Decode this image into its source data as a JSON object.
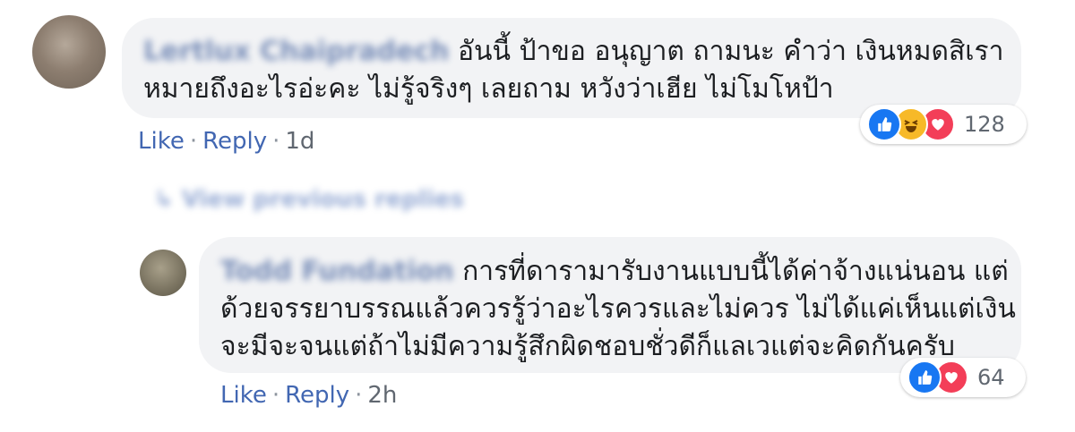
{
  "comments": [
    {
      "author": "Lertlux Chaipradech",
      "lines": [
        "อันนี้ ป้าขอ อนุญาต ถามนะ คำว่า เงินหมดสิเรา",
        "หมายถึงอะไรอ่ะคะ ไม่รู้จริงๆ เลยถาม หวังว่าเฮีย ไม่โมโหป้า"
      ],
      "like_label": "Like",
      "reply_label": "Reply",
      "time": "1d",
      "reactions": [
        "like-icon",
        "haha-icon",
        "love-icon"
      ],
      "reaction_count": "128"
    }
  ],
  "view_previous": "View previous replies",
  "replies": [
    {
      "author": "Todd Fundation",
      "lines": [
        "การที่ดารามารับงานแบบนี้ได้ค่าจ้างแน่นอน แต่",
        "ด้วยจรรยาบรรณแล้วควรรู้ว่าอะไรควรและไม่ควร ไม่ได้แค่เห็นแต่เงิน",
        "จะมีจะจนแต่ถ้าไม่มีความรู้สึกผิดชอบชั่วดีก็แลเวแต่จะคิดกันครับ"
      ],
      "like_label": "Like",
      "reply_label": "Reply",
      "time": "2h",
      "reactions": [
        "like-icon",
        "love-icon"
      ],
      "reaction_count": "64"
    }
  ],
  "colors": {
    "bubble": "#f2f3f5",
    "link": "#4267b2",
    "meta": "#606770",
    "like": "#1877f2",
    "love": "#f33e58",
    "haha": "#f7b928"
  }
}
